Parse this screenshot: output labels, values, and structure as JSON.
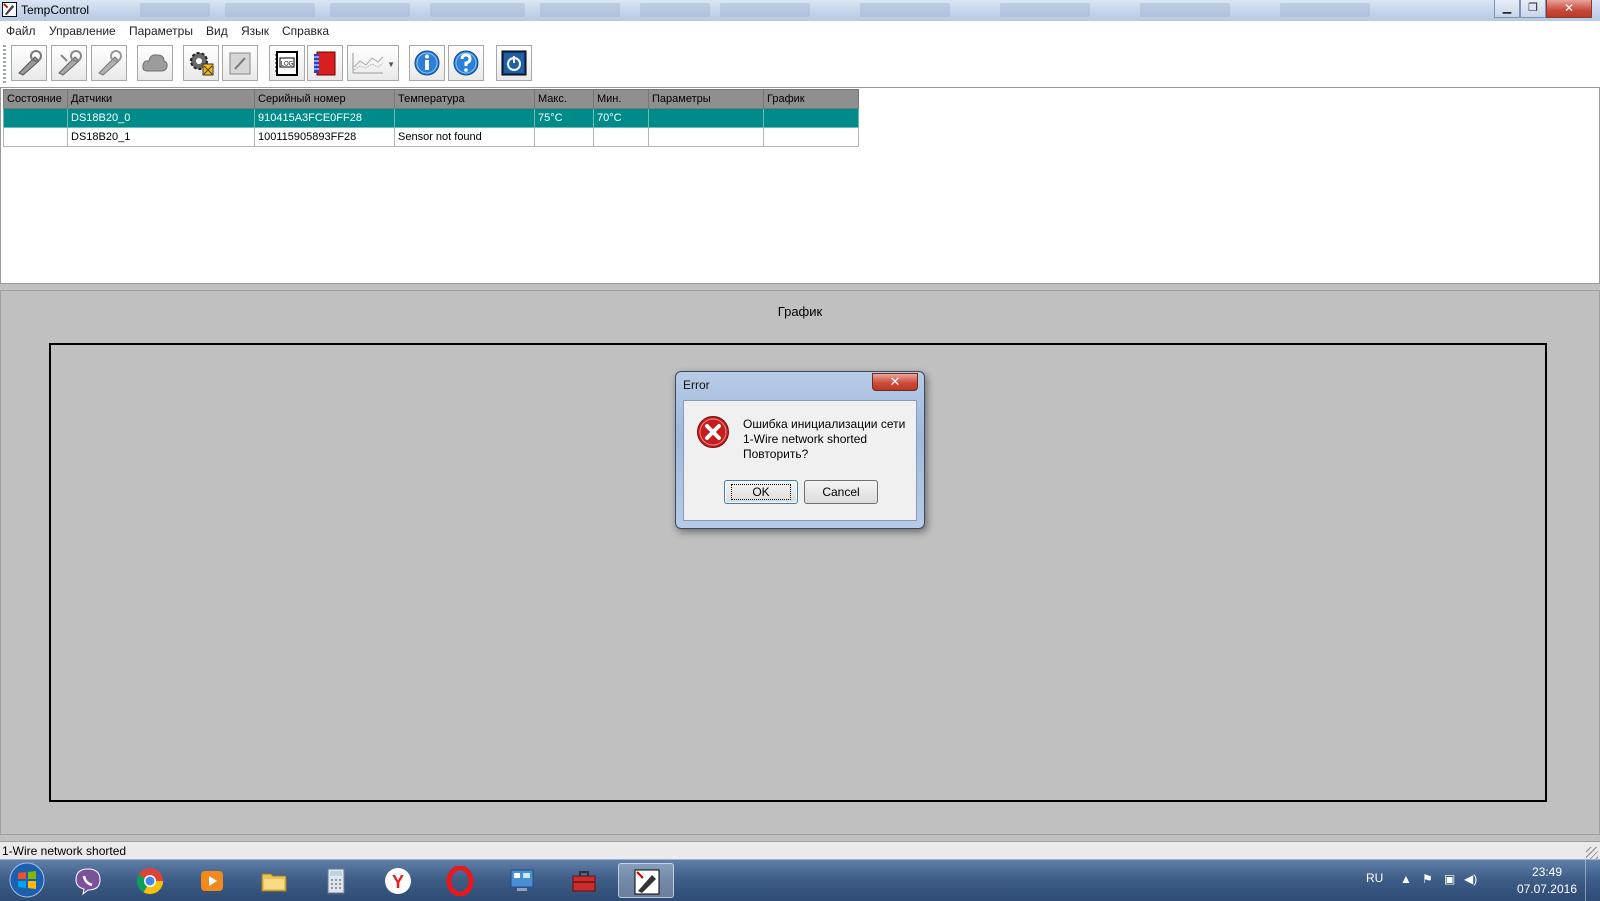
{
  "window": {
    "title": "TempControl"
  },
  "menu": {
    "items": [
      "Файл",
      "Управление",
      "Параметры",
      "Вид",
      "Язык",
      "Справка"
    ]
  },
  "toolbar": {
    "buttons": [
      "sensor-connect-icon",
      "sensor-disconnect-icon",
      "sensor-search-icon",
      "cloud-icon",
      "settings-gear-icon",
      "edit-note-icon",
      "log-icon",
      "book-icon",
      "chart-icon",
      "info-icon",
      "help-icon",
      "power-icon"
    ],
    "log_label": "LOG"
  },
  "grid": {
    "columns": [
      "Состояние",
      "Датчики",
      "Серийный номер",
      "Температура",
      "Макс.",
      "Мин.",
      "Параметры",
      "График"
    ],
    "rows": [
      {
        "status": "",
        "sensor": "DS18B20_0",
        "serial": "910415A3FCE0FF28",
        "temperature": "",
        "max": "75°C",
        "min": "70°C",
        "params": "",
        "chart": "",
        "selected": true
      },
      {
        "status": "",
        "sensor": "DS18B20_1",
        "serial": "100115905893FF28",
        "temperature": "Sensor not found",
        "max": "",
        "min": "",
        "params": "",
        "chart": "",
        "selected": false
      }
    ]
  },
  "chart": {
    "title": "График"
  },
  "dialog": {
    "title": "Error",
    "line1": "Ошибка инициализации сети",
    "line2": "1-Wire network shorted",
    "line3": "Повторить?",
    "ok_label": "OK",
    "cancel_label": "Cancel"
  },
  "status": {
    "text": "1-Wire network shorted"
  },
  "taskbar": {
    "apps": [
      "viber-icon",
      "chrome-icon",
      "media-player-icon",
      "explorer-folder-icon",
      "calculator-icon",
      "yandex-icon",
      "opera-icon",
      "control-panel-icon",
      "toolbox-icon",
      "tempcontrol-icon"
    ],
    "yandex_letter": "Y",
    "lang": "RU",
    "time": "23:49",
    "date": "07.07.2016"
  },
  "colors": {
    "selection": "#008b8b",
    "header": "#8f8f8f",
    "chart_bg": "#c0c0c0"
  }
}
